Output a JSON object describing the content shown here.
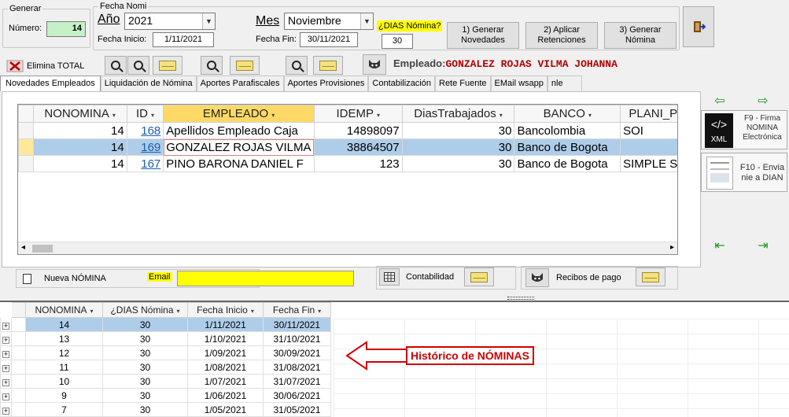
{
  "generar": {
    "legend": "Generar",
    "numero_label": "Número:",
    "numero_value": "14"
  },
  "fecha": {
    "legend": "Fecha Nomi",
    "anio_label": "Año",
    "anio_value": "2021",
    "fecha_inicio_label": "Fecha Inicio:",
    "fecha_inicio_value": "1/11/2021",
    "mes_label": "Mes",
    "mes_value": "Noviembre",
    "fecha_fin_label": "Fecha Fin:",
    "fecha_fin_value": "30/11/2021",
    "dias_label": "¿DIAS Nómina?",
    "dias_value": "30"
  },
  "actions": {
    "b1": "1) Generar",
    "b1b": "Novedades",
    "b2": "2) Aplicar",
    "b2b": "Retenciones",
    "b3": "3) Generar",
    "b3b": "Nómina"
  },
  "toolbar": {
    "elimina": "Elimina TOTAL",
    "empleado_label": "Empleado:",
    "empleado_value": "GONZALEZ ROJAS VILMA JOHANNA"
  },
  "tabs": [
    "Novedades Empleados",
    "Liquidación de Nómina",
    "Aportes Parafiscales",
    "Aportes Provisiones",
    "Contabilización",
    "Rete Fuente",
    "EMail wsapp",
    "nle"
  ],
  "grid1": {
    "columns": [
      "NONOMINA",
      "ID",
      "EMPLEADO",
      "IDEMP",
      "DiasTrabajados",
      "BANCO",
      "PLANI_PILA"
    ],
    "rows": [
      [
        "14",
        "168",
        "Apellidos  Empleado Caja",
        "14898097",
        "30",
        "Bancolombia",
        "SOI"
      ],
      [
        "14",
        "169",
        "GONZALEZ ROJAS VILMA",
        "38864507",
        "30",
        "Banco de Bogota",
        ""
      ],
      [
        "14",
        "167",
        "PINO BARONA DANIEL F",
        "123",
        "30",
        "Banco de Bogota",
        "SIMPLE S.A"
      ]
    ]
  },
  "side": {
    "f9a": "F9 - Firma",
    "f9b": "NOMINA",
    "f9c": "Electrónica",
    "xml": "XML",
    "f10a": "F10 - Envia",
    "f10b": "nie a DIAN"
  },
  "bottom": {
    "nueva": "Nueva NÓMINA",
    "email_label": "Email",
    "email_value": "",
    "contabilidad": "Contabilidad",
    "recibos": "Recibos de pago"
  },
  "grid2": {
    "columns": [
      "NONOMINA",
      "¿DIAS Nómina",
      "Fecha Inicio",
      "Fecha Fin"
    ],
    "rows": [
      [
        "14",
        "30",
        "1/11/2021",
        "30/11/2021"
      ],
      [
        "13",
        "30",
        "1/10/2021",
        "31/10/2021"
      ],
      [
        "12",
        "30",
        "1/09/2021",
        "30/09/2021"
      ],
      [
        "11",
        "30",
        "1/08/2021",
        "31/08/2021"
      ],
      [
        "10",
        "30",
        "1/07/2021",
        "31/07/2021"
      ],
      [
        "9",
        "30",
        "1/06/2021",
        "30/06/2021"
      ],
      [
        "7",
        "30",
        "1/05/2021",
        "31/05/2021"
      ]
    ],
    "annotation": "Histórico de NÓMINAS"
  }
}
